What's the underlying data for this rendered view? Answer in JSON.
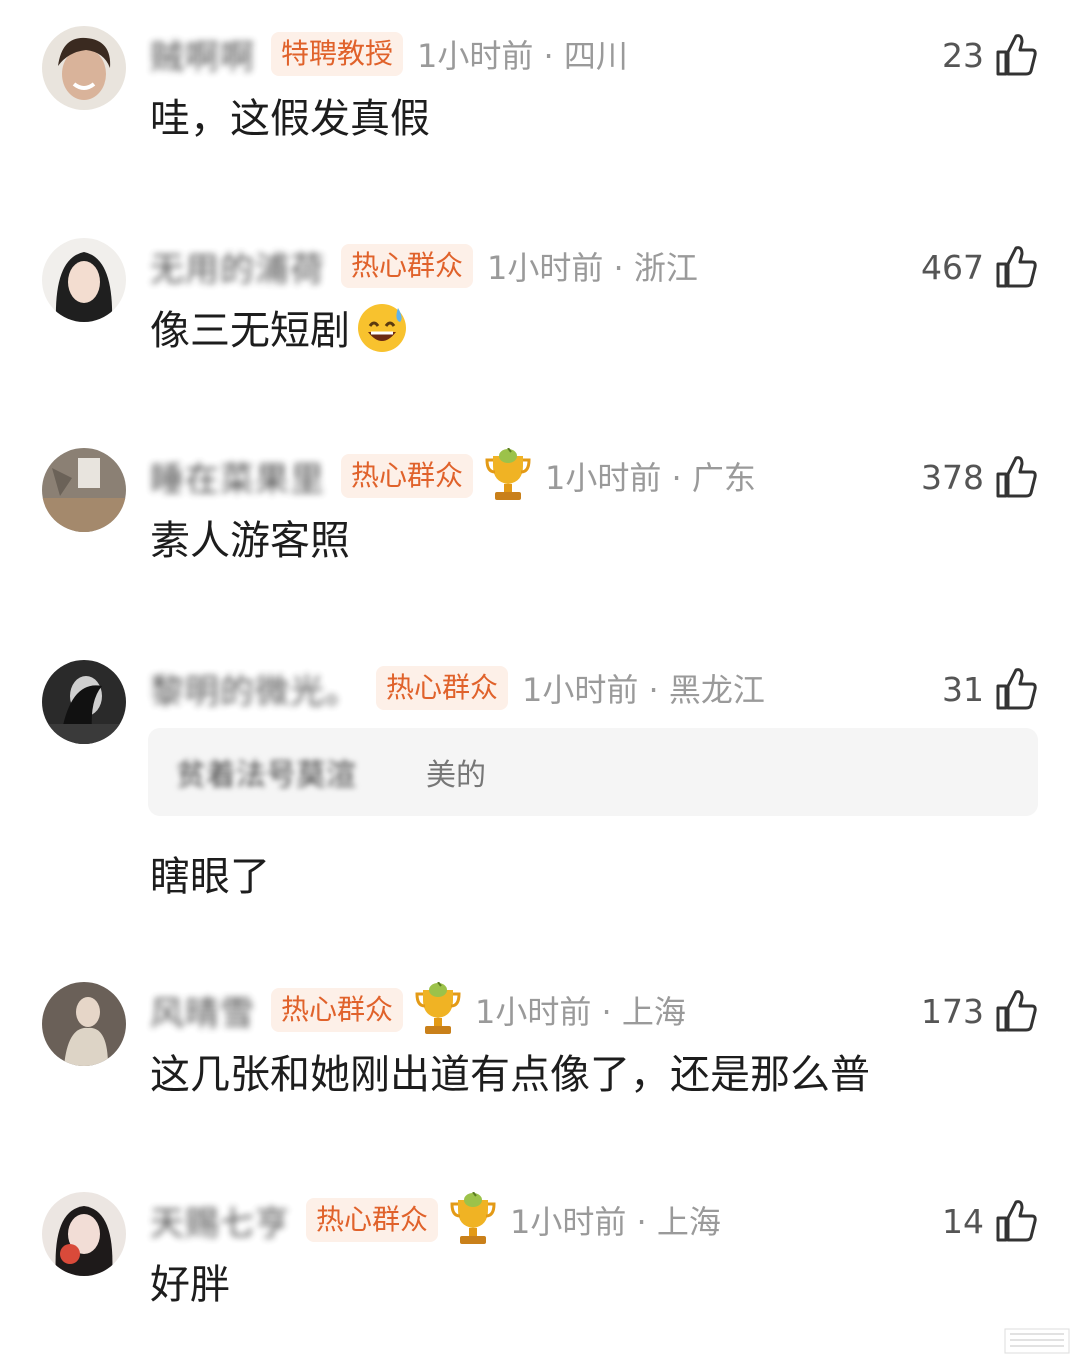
{
  "comments": [
    {
      "username": "贼啊啊",
      "badge": "特聘教授",
      "meta": "1小时前 · 四川",
      "likes": "23",
      "text": "哇，这假发真假",
      "trophy": false,
      "avatar_color": "#c9b8a6",
      "emoji": ""
    },
    {
      "username": "无用的浦荷",
      "badge": "热心群众",
      "meta": "1小时前 · 浙江",
      "likes": "467",
      "text": "像三无短剧",
      "trophy": false,
      "avatar_color": "#3b3b3b",
      "emoji": "sweat-smile-emoji"
    },
    {
      "username": "睡在菜果里",
      "badge": "热心群众",
      "meta": "1小时前 · 广东",
      "likes": "378",
      "text": "素人游客照",
      "trophy": true,
      "avatar_color": "#8b8074",
      "emoji": ""
    },
    {
      "username": "黎明的微光。",
      "badge": "热心群众",
      "meta": "1小时前 · 黑龙江",
      "likes": "31",
      "text": "瞎眼了",
      "trophy": false,
      "avatar_color": "#2a2a2a",
      "emoji": "",
      "quote": {
        "author": "贫着法号莫渲",
        "text": "美的"
      }
    },
    {
      "username": "风晴雪",
      "badge": "热心群众",
      "meta": "1小时前 · 上海",
      "likes": "173",
      "text": "这几张和她刚出道有点像了，还是那么普",
      "trophy": true,
      "avatar_color": "#6a6058",
      "emoji": ""
    },
    {
      "username": "天赐七亨",
      "badge": "热心群众",
      "meta": "1小时前 · 上海",
      "likes": "14",
      "text": "好胖",
      "trophy": true,
      "avatar_color": "#d8c6c0",
      "emoji": ""
    }
  ],
  "colors": {
    "badge_text": "#e0622b",
    "badge_bg": "#fdf0e8",
    "meta": "#9a9a9a",
    "quote_bg": "#f5f5f5"
  }
}
